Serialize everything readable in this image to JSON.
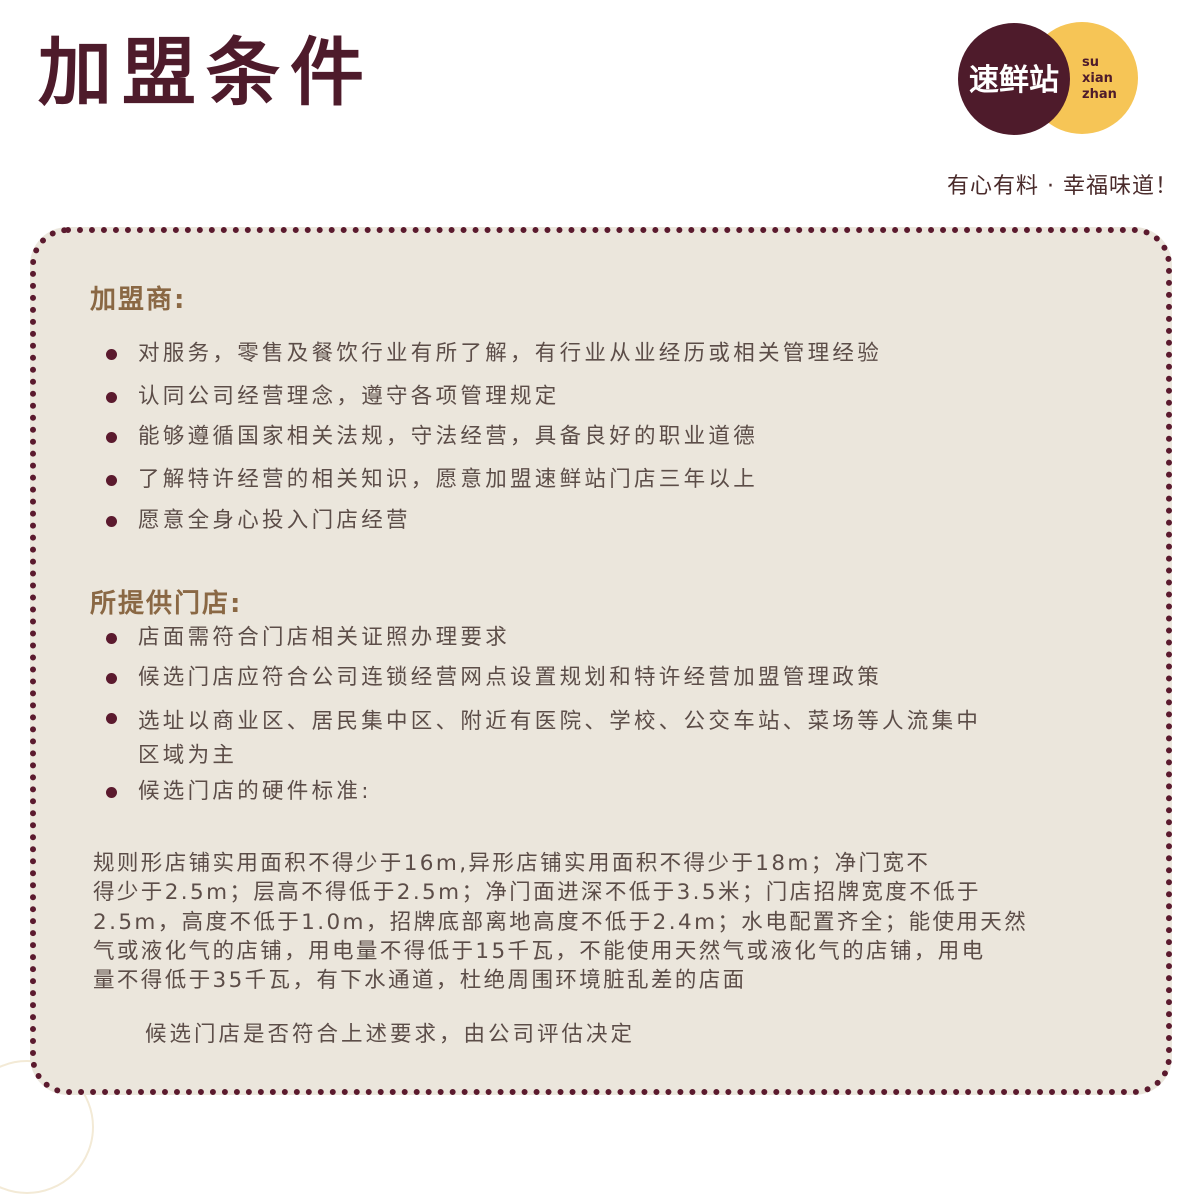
{
  "header": {
    "title": "加盟条件",
    "slogan": "有心有料 · 幸福味道！"
  },
  "logo": {
    "cn": "速鲜站",
    "en_lines": [
      "su",
      "xian",
      "zhan"
    ],
    "colors": {
      "dark": "#4e1b2b",
      "yellow": "#f6c556"
    }
  },
  "franchisee": {
    "title": "加盟商:",
    "items": [
      "对服务，零售及餐饮行业有所了解，有行业从业经历或相关管理经验",
      "认同公司经营理念，遵守各项管理规定",
      "能够遵循国家相关法规，守法经营，具备良好的职业道德",
      "了解特许经营的相关知识，愿意加盟速鲜站门店三年以上",
      "愿意全身心投入门店经营"
    ]
  },
  "store": {
    "title": "所提供门店:",
    "items": [
      "店面需符合门店相关证照办理要求",
      "候选门店应符合公司连锁经营网点设置规划和特许经营加盟管理政策",
      "选址以商业区、居民集中区、附近有医院、学校、公交车站、菜场等人流集中",
      "区域为主",
      "候选门店的硬件标准:"
    ]
  },
  "hardware": {
    "lines": [
      "规则形店铺实用面积不得少于16m,异形店铺实用面积不得少于18m；净门宽不",
      "得少于2.5m；层高不得低于2.5m；净门面进深不低于3.5米；门店招牌宽度不低于",
      "2.5m，高度不低于1.0m，招牌底部离地高度不低于2.4m；水电配置齐全；能使用天然",
      "气或液化气的店铺，用电量不得低于15千瓦，不能使用天然气或液化气的店铺，用电",
      "量不得低于35千瓦，有下水通道，杜绝周围环境脏乱差的店面"
    ]
  },
  "closing": "候选门店是否符合上述要求，由公司评估决定",
  "colors": {
    "accent": "#4e1b2b",
    "panel": "#ebe6dc",
    "heading": "#8a6844",
    "text": "#5c4d48"
  }
}
